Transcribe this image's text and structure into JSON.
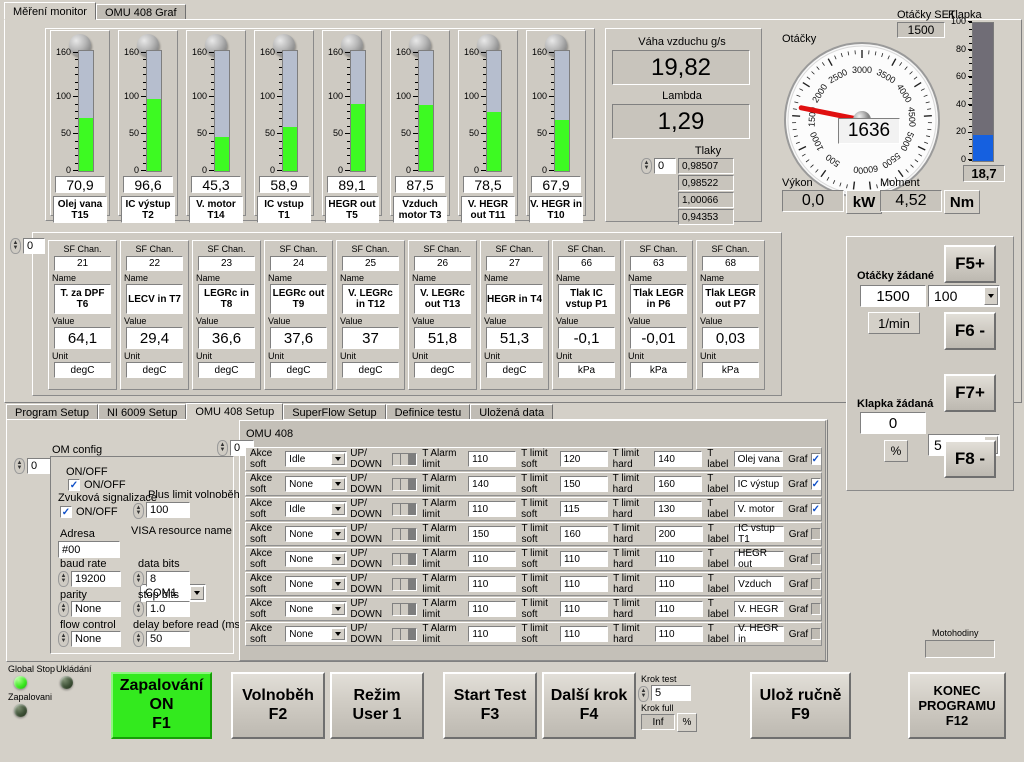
{
  "top_tabs": [
    {
      "label": "Měření monitor",
      "active": true
    },
    {
      "label": "OMU 408 Graf",
      "active": false
    }
  ],
  "thermometers": {
    "scale": {
      "min": 0,
      "max": 160,
      "ticks": [
        0,
        50,
        100,
        160
      ]
    },
    "items": [
      {
        "value": "70,9",
        "num": 70.9,
        "name": "Olej vana T15"
      },
      {
        "value": "96,6",
        "num": 96.6,
        "name": "IC výstup T2"
      },
      {
        "value": "45,3",
        "num": 45.3,
        "name": "V. motor T14"
      },
      {
        "value": "58,9",
        "num": 58.9,
        "name": "IC vstup T1"
      },
      {
        "value": "89,1",
        "num": 89.1,
        "name": "HEGR out T5"
      },
      {
        "value": "87,5",
        "num": 87.5,
        "name": "Vzduch motor T3"
      },
      {
        "value": "78,5",
        "num": 78.5,
        "name": "V. HEGR out T11"
      },
      {
        "value": "67,9",
        "num": 67.9,
        "name": "V. HEGR in T10"
      }
    ]
  },
  "air": {
    "weight_label": "Váha vzduchu g/s",
    "weight_value": "19,82",
    "lambda_label": "Lambda",
    "lambda_value": "1,29",
    "pressures_label": "Tlaky",
    "pressures_index": "0",
    "pressures": [
      "0,98507",
      "0,98522",
      "1,00066",
      "0,94353"
    ]
  },
  "tacho": {
    "label": "Otáčky",
    "value": "1636",
    "needle_rpm": 1636,
    "ticks": [
      "0",
      "500",
      "1000",
      "1500",
      "2000",
      "2500",
      "3000",
      "3500",
      "4000",
      "4500",
      "5000",
      "5500",
      "6000"
    ],
    "set_label": "Otáčky SET",
    "set_value": "1500",
    "power_label": "Výkon",
    "power_value": "0,0",
    "power_unit": "kW",
    "torque_label": "Moment",
    "torque_value": "4,52",
    "torque_unit": "Nm",
    "throttle_label": "Klapka",
    "throttle_value": "18,7",
    "throttle_num": 18.7,
    "throttle_ticks": [
      "0",
      "20",
      "40",
      "60",
      "80",
      "100"
    ]
  },
  "sf_panel": {
    "index": "0",
    "cap_chan": "SF Chan.",
    "cap_name": "Name",
    "cap_value": "Value",
    "cap_unit": "Unit",
    "channels": [
      {
        "chan": "21",
        "name": "T. za DPF T6",
        "value": "64,1",
        "unit": "degC"
      },
      {
        "chan": "22",
        "name": "LECV in T7",
        "value": "29,4",
        "unit": "degC"
      },
      {
        "chan": "23",
        "name": "LEGRc in T8",
        "value": "36,6",
        "unit": "degC"
      },
      {
        "chan": "24",
        "name": "LEGRc out T9",
        "value": "37,6",
        "unit": "degC"
      },
      {
        "chan": "25",
        "name": "V. LEGRc in T12",
        "value": "37",
        "unit": "degC"
      },
      {
        "chan": "26",
        "name": "V. LEGRc out T13",
        "value": "51,8",
        "unit": "degC"
      },
      {
        "chan": "27",
        "name": "HEGR in T4",
        "value": "51,3",
        "unit": "degC"
      },
      {
        "chan": "66",
        "name": "Tlak IC vstup P1",
        "value": "-0,1",
        "unit": "kPa"
      },
      {
        "chan": "63",
        "name": "Tlak LEGR in P6",
        "value": "-0,01",
        "unit": "kPa"
      },
      {
        "chan": "68",
        "name": "Tlak LEGR out P7",
        "value": "0,03",
        "unit": "kPa"
      }
    ]
  },
  "setpoints": {
    "rpm_label": "Otáčky žádané",
    "rpm_value": "1500",
    "rpm_step": "100",
    "rpm_unit": "1/min",
    "rpm_up": "F5+",
    "rpm_down": "F6 -",
    "throttle_label": "Klapka žádaná",
    "throttle_value": "0",
    "throttle_step": "5",
    "throttle_unit": "%",
    "throttle_up": "F7+",
    "throttle_down": "F8 -"
  },
  "setup_tabs": [
    {
      "label": "Program Setup",
      "active": false
    },
    {
      "label": "NI 6009 Setup",
      "active": false
    },
    {
      "label": "OMU 408 Setup",
      "active": true
    },
    {
      "label": "SuperFlow Setup",
      "active": false
    },
    {
      "label": "Definice testu",
      "active": false
    },
    {
      "label": "Uložená data",
      "active": false
    }
  ],
  "om_config": {
    "outer_index": "0",
    "title": "OM config",
    "onoff_title": "ON/OFF",
    "onoff_label": "ON/OFF",
    "onoff_checked": true,
    "sound_title": "Zvuková signalizace",
    "sound_label": "ON/OFF",
    "sound_checked": true,
    "plus_limit_label": "Plus limit volnoběh",
    "plus_limit_value": "100",
    "address_label": "Adresa",
    "address_value": "#00",
    "visa_label": "VISA resource name",
    "visa_value": "COM1",
    "baud_label": "baud rate",
    "baud_value": "19200",
    "databits_label": "data bits",
    "databits_value": "8",
    "parity_label": "parity",
    "parity_value": "None",
    "stopbits_label": "stop bits",
    "stopbits_value": "1.0",
    "flow_label": "flow control",
    "flow_value": "None",
    "delay_label": "delay before read (ms)",
    "delay_value": "50"
  },
  "omu408": {
    "title": "OMU 408",
    "index": "0",
    "col_action": "Akce soft",
    "col_updown": "UP/ DOWN",
    "col_alarm": "T Alarm limit",
    "col_soft": "T limit soft",
    "col_hard": "T limit hard",
    "col_label": "T label",
    "col_graf": "Graf",
    "rows": [
      {
        "action": "Idle",
        "alarm": "110",
        "soft": "120",
        "hard": "140",
        "label": "Olej vana",
        "graf": true
      },
      {
        "action": "None",
        "alarm": "140",
        "soft": "150",
        "hard": "160",
        "label": "IC výstup",
        "graf": true
      },
      {
        "action": "Idle",
        "alarm": "110",
        "soft": "115",
        "hard": "130",
        "label": "V. motor",
        "graf": true
      },
      {
        "action": "None",
        "alarm": "150",
        "soft": "160",
        "hard": "200",
        "label": "IC vstup T1",
        "graf": false
      },
      {
        "action": "None",
        "alarm": "110",
        "soft": "110",
        "hard": "110",
        "label": "HEGR out",
        "graf": false
      },
      {
        "action": "None",
        "alarm": "110",
        "soft": "110",
        "hard": "110",
        "label": "Vzduch",
        "graf": false
      },
      {
        "action": "None",
        "alarm": "110",
        "soft": "110",
        "hard": "110",
        "label": "V. HEGR",
        "graf": false
      },
      {
        "action": "None",
        "alarm": "110",
        "soft": "110",
        "hard": "110",
        "label": "V. HEGR in",
        "graf": false
      }
    ]
  },
  "status": {
    "global_stop_label": "Global Stop",
    "global_stop_on": true,
    "saving_label": "Ukládání",
    "saving_on": false,
    "ignition_label": "Zapalovani",
    "ignition_on": false
  },
  "bottom_buttons": [
    {
      "line1": "Zapalování",
      "line2": "ON",
      "line3": "F1",
      "accent": "#33ea1e"
    },
    {
      "line1": "Volnoběh",
      "line2": "F2",
      "line3": ""
    },
    {
      "line1": "Režim",
      "line2": "User 1",
      "line3": ""
    },
    {
      "line1": "Start Test",
      "line2": "F3",
      "line3": ""
    },
    {
      "line1": "Další krok",
      "line2": "F4",
      "line3": ""
    },
    {
      "line1": "Ulož ručně",
      "line2": "F9",
      "line3": ""
    },
    {
      "line1": "KONEC",
      "line2": "PROGRAMU",
      "line3": "F12"
    }
  ],
  "step": {
    "krok_test_label": "Krok test",
    "krok_test_value": "5",
    "krok_full_label": "Krok full",
    "krok_full_value": "Inf",
    "krok_full_unit": "%"
  },
  "motohodiny": {
    "label": "Motohodiny",
    "value": ""
  },
  "colors": {
    "bg": "#d4d0c8",
    "green_led": "#33ea1e",
    "thermo_fill": "#3dfa22",
    "throttle_fill": "#1560e0",
    "needle": "#e01010"
  }
}
